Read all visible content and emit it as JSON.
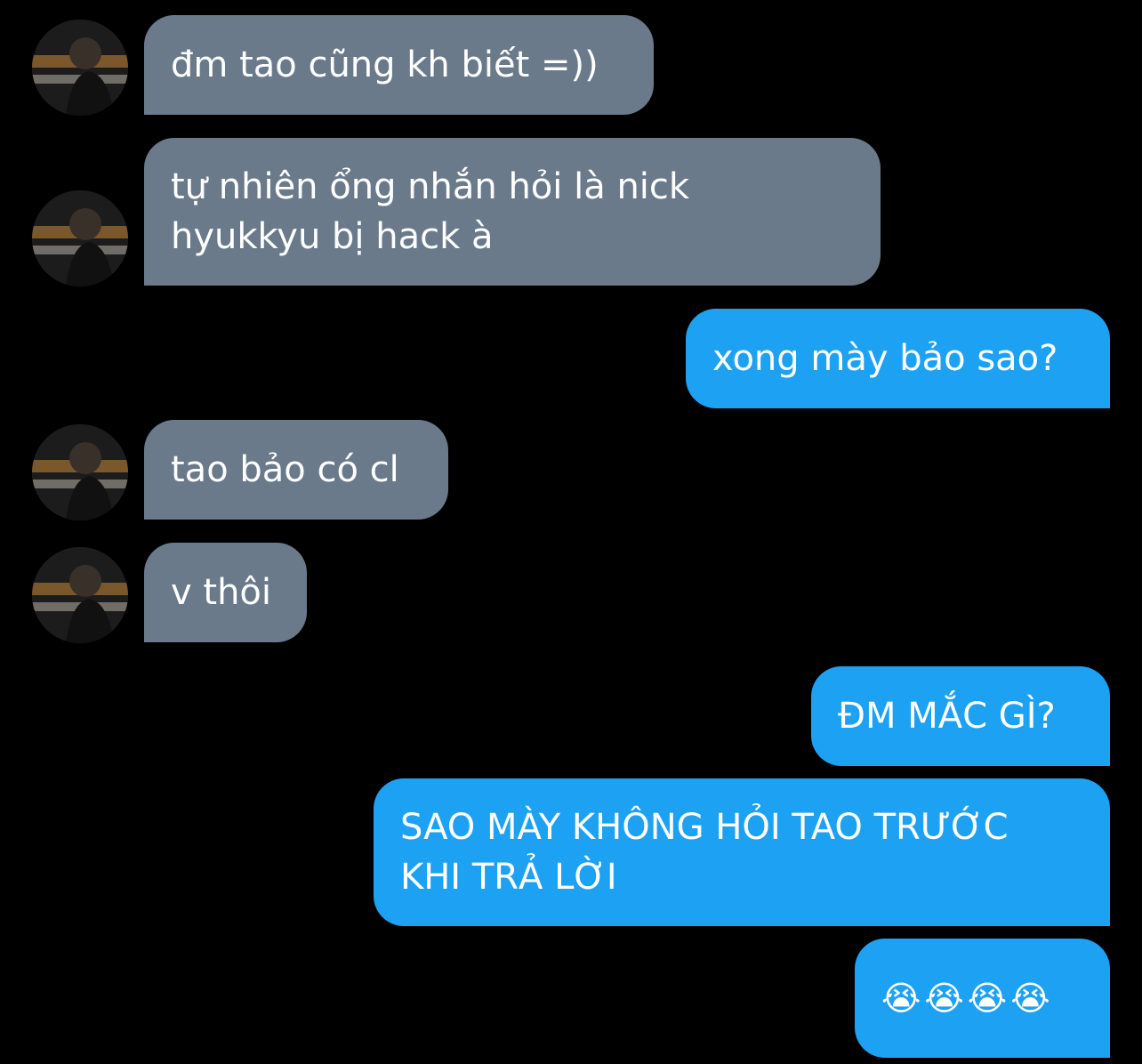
{
  "colors": {
    "background": "#000000",
    "incoming_bubble": "#6a7a8a",
    "outgoing_bubble": "#1da1f2",
    "text": "#ffffff"
  },
  "messages": [
    {
      "sender": "them",
      "text": "đm tao cũng kh biết =))"
    },
    {
      "sender": "them",
      "text": "tự nhiên ổng nhắn hỏi là nick\nhyukkyu bị hack à"
    },
    {
      "sender": "me",
      "text": "xong mày bảo sao?"
    },
    {
      "sender": "them",
      "text": "tao bảo có cl"
    },
    {
      "sender": "them",
      "text": "v thôi"
    },
    {
      "sender": "me",
      "text": "ĐM MẮC GÌ?"
    },
    {
      "sender": "me",
      "text": "SAO MÀY KHÔNG HỎI TAO TRƯỚC\nKHI TRẢ LỜI"
    },
    {
      "sender": "me",
      "text": "😭😭😭😭"
    }
  ],
  "icons": {
    "avatar": "profile-photo-avatar"
  }
}
